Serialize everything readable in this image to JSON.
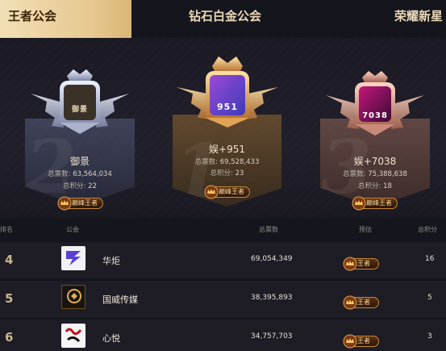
{
  "tabs": [
    {
      "label": "王者公会",
      "active": true
    },
    {
      "label": "钻石白金公会",
      "active": false
    },
    {
      "label": "荣耀新星",
      "active": false
    }
  ],
  "podium": [
    {
      "place": "2",
      "name": "御景",
      "votes_label": "总票数:",
      "votes": "63,564,034",
      "points_label": "总积分:",
      "points": "22",
      "rank_title": "巅峰王者",
      "logo_text": "御景"
    },
    {
      "place": "1",
      "name": "娱+951",
      "votes_label": "总票数:",
      "votes": "69,528,433",
      "points_label": "总积分:",
      "points": "23",
      "rank_title": "巅峰王者",
      "logo_text": "951"
    },
    {
      "place": "3",
      "name": "娱+7038",
      "votes_label": "总票数:",
      "votes": "75,388,638",
      "points_label": "总积分:",
      "points": "18",
      "rank_title": "巅峰王者",
      "logo_text": "7038"
    }
  ],
  "table": {
    "headers": {
      "rank": "排名",
      "guild": "公会",
      "votes": "总票数",
      "forecast": "预估",
      "points": "总积分"
    },
    "rows": [
      {
        "rank": "4",
        "name": "华炬",
        "votes": "69,054,349",
        "rank_title": "王者",
        "points": "16"
      },
      {
        "rank": "5",
        "name": "国威传媒",
        "votes": "38,395,893",
        "rank_title": "王者",
        "points": "5"
      },
      {
        "rank": "6",
        "name": "心悦",
        "votes": "34,757,703",
        "rank_title": "王者",
        "points": "3"
      }
    ]
  },
  "colors": {
    "accent_gold": "#e6c890",
    "background": "#15151d",
    "row_background": "#1e1d26"
  }
}
